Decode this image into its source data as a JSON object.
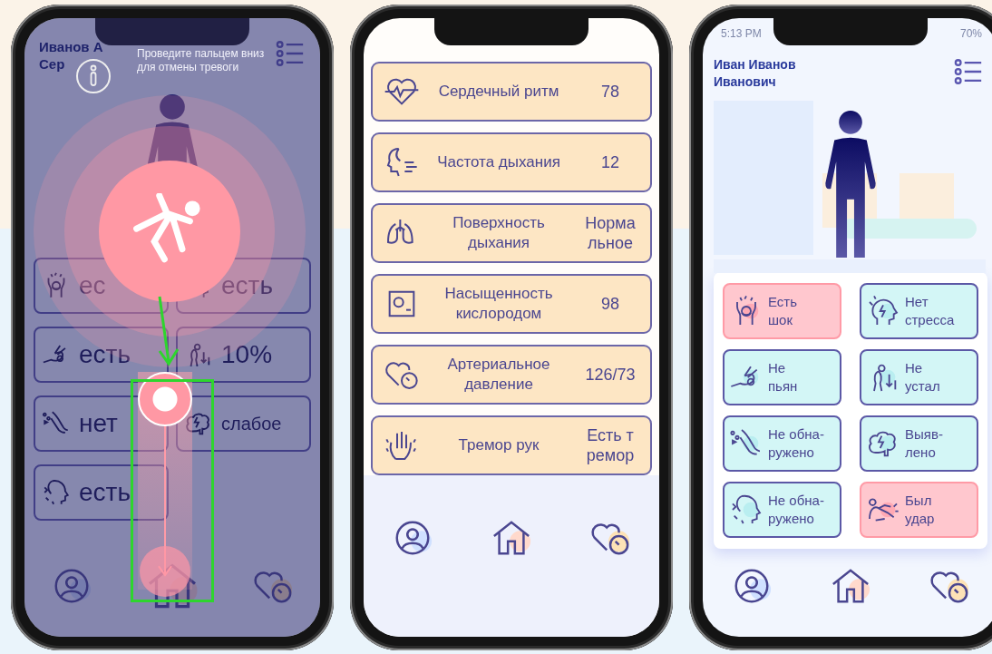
{
  "alarm_screen": {
    "user_name": [
      "Иванов А",
      "Сер"
    ],
    "hint": "Проведите пальцем вниз для отмены тревоги",
    "tiles": [
      {
        "value": "ес"
      },
      {
        "value": "есть"
      },
      {
        "value": "есть"
      },
      {
        "value": "10%"
      },
      {
        "value": "нет"
      },
      {
        "value": "слабое"
      },
      {
        "value": "есть"
      }
    ]
  },
  "metrics_screen": {
    "metrics": [
      {
        "label": "Сердечный ритм",
        "value": "78"
      },
      {
        "label": "Частота дыхания",
        "value": "12"
      },
      {
        "label": "Поверхность\nдыхания",
        "value": "Норма\nльное"
      },
      {
        "label": "Насыщенность\nкислородом",
        "value": "98"
      },
      {
        "label": "Артериальное\nдавление",
        "value": "126/73"
      },
      {
        "label": "Тремор рук",
        "value": "Есть т\nремор"
      }
    ]
  },
  "status_screen": {
    "status_bar": {
      "time": "5:13 PM",
      "battery": "70%"
    },
    "user_name": "Иван Иванов\nИванович",
    "tiles": [
      {
        "text": "Есть\nшок",
        "alert": true
      },
      {
        "text": "Нет\nстресса",
        "alert": false
      },
      {
        "text": "Не\nпьян",
        "alert": false
      },
      {
        "text": "Не\nустал",
        "alert": false
      },
      {
        "text": "Не обна-\nружено",
        "alert": false
      },
      {
        "text": "Выяв-\nлено",
        "alert": false
      },
      {
        "text": "Не обна-\nружено",
        "alert": false
      },
      {
        "text": "Был\nудар",
        "alert": true
      }
    ]
  }
}
